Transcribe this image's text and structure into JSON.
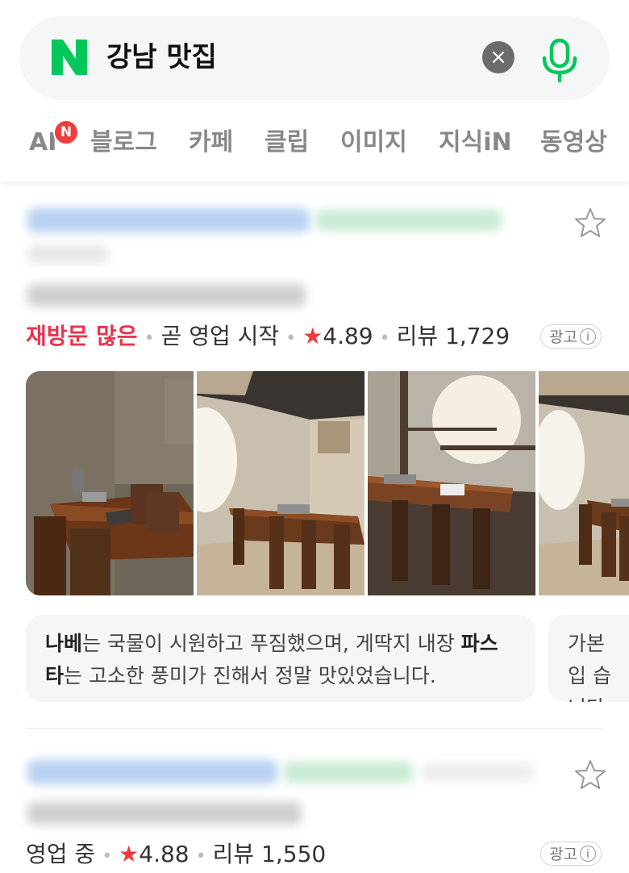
{
  "search": {
    "logo_letter": "N",
    "query": "강남 맛집",
    "clear_symbol": "×"
  },
  "tabs": [
    {
      "label": "AI",
      "badge": "N"
    },
    {
      "label": "블로그"
    },
    {
      "label": "카페"
    },
    {
      "label": "클립"
    },
    {
      "label": "이미지"
    },
    {
      "label": "지식iN"
    },
    {
      "label": "동영상"
    }
  ],
  "results": [
    {
      "revisit": "재방문 많은",
      "status": "곧 영업 시작",
      "rating": "4.89",
      "review_label": "리뷰",
      "review_count": "1,729",
      "ad_label": "광고",
      "ad_info": "i",
      "snippets": [
        {
          "bold1": "나베",
          "text1": "는 국물이 시원하고 푸짐했으며, 게딱지 내장 ",
          "bold2": "파스타",
          "text2": "는 고소한 풍미가 진해서 정말 맛있었습니다."
        },
        {
          "text1": "가본 입 습니다"
        }
      ]
    },
    {
      "status": "영업 중",
      "rating": "4.88",
      "review_label": "리뷰",
      "review_count": "1,550",
      "ad_label": "광고",
      "ad_info": "i"
    }
  ],
  "colors": {
    "naver_green": "#03c75a",
    "revisit_red": "#e8344e",
    "star_red": "#f23a3a",
    "badge_red": "#f03c3c"
  },
  "icons": [
    "naver-logo-icon",
    "clear-icon",
    "microphone-icon",
    "bookmark-star-icon",
    "rating-star-icon",
    "info-icon"
  ]
}
